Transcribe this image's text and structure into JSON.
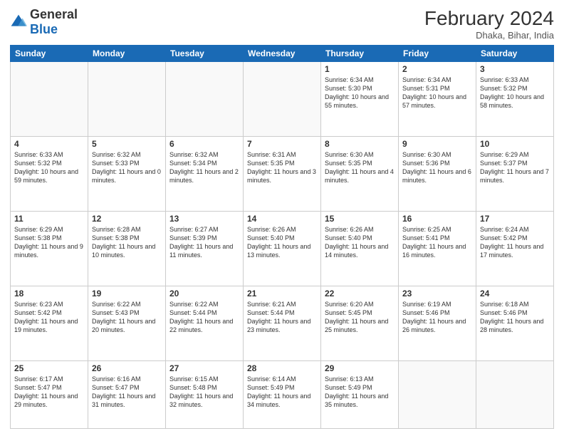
{
  "logo": {
    "general": "General",
    "blue": "Blue"
  },
  "header": {
    "title": "February 2024",
    "subtitle": "Dhaka, Bihar, India"
  },
  "weekdays": [
    "Sunday",
    "Monday",
    "Tuesday",
    "Wednesday",
    "Thursday",
    "Friday",
    "Saturday"
  ],
  "weeks": [
    [
      {
        "day": "",
        "sunrise": "",
        "sunset": "",
        "daylight": ""
      },
      {
        "day": "",
        "sunrise": "",
        "sunset": "",
        "daylight": ""
      },
      {
        "day": "",
        "sunrise": "",
        "sunset": "",
        "daylight": ""
      },
      {
        "day": "",
        "sunrise": "",
        "sunset": "",
        "daylight": ""
      },
      {
        "day": "1",
        "sunrise": "Sunrise: 6:34 AM",
        "sunset": "Sunset: 5:30 PM",
        "daylight": "Daylight: 10 hours and 55 minutes."
      },
      {
        "day": "2",
        "sunrise": "Sunrise: 6:34 AM",
        "sunset": "Sunset: 5:31 PM",
        "daylight": "Daylight: 10 hours and 57 minutes."
      },
      {
        "day": "3",
        "sunrise": "Sunrise: 6:33 AM",
        "sunset": "Sunset: 5:32 PM",
        "daylight": "Daylight: 10 hours and 58 minutes."
      }
    ],
    [
      {
        "day": "4",
        "sunrise": "Sunrise: 6:33 AM",
        "sunset": "Sunset: 5:32 PM",
        "daylight": "Daylight: 10 hours and 59 minutes."
      },
      {
        "day": "5",
        "sunrise": "Sunrise: 6:32 AM",
        "sunset": "Sunset: 5:33 PM",
        "daylight": "Daylight: 11 hours and 0 minutes."
      },
      {
        "day": "6",
        "sunrise": "Sunrise: 6:32 AM",
        "sunset": "Sunset: 5:34 PM",
        "daylight": "Daylight: 11 hours and 2 minutes."
      },
      {
        "day": "7",
        "sunrise": "Sunrise: 6:31 AM",
        "sunset": "Sunset: 5:35 PM",
        "daylight": "Daylight: 11 hours and 3 minutes."
      },
      {
        "day": "8",
        "sunrise": "Sunrise: 6:30 AM",
        "sunset": "Sunset: 5:35 PM",
        "daylight": "Daylight: 11 hours and 4 minutes."
      },
      {
        "day": "9",
        "sunrise": "Sunrise: 6:30 AM",
        "sunset": "Sunset: 5:36 PM",
        "daylight": "Daylight: 11 hours and 6 minutes."
      },
      {
        "day": "10",
        "sunrise": "Sunrise: 6:29 AM",
        "sunset": "Sunset: 5:37 PM",
        "daylight": "Daylight: 11 hours and 7 minutes."
      }
    ],
    [
      {
        "day": "11",
        "sunrise": "Sunrise: 6:29 AM",
        "sunset": "Sunset: 5:38 PM",
        "daylight": "Daylight: 11 hours and 9 minutes."
      },
      {
        "day": "12",
        "sunrise": "Sunrise: 6:28 AM",
        "sunset": "Sunset: 5:38 PM",
        "daylight": "Daylight: 11 hours and 10 minutes."
      },
      {
        "day": "13",
        "sunrise": "Sunrise: 6:27 AM",
        "sunset": "Sunset: 5:39 PM",
        "daylight": "Daylight: 11 hours and 11 minutes."
      },
      {
        "day": "14",
        "sunrise": "Sunrise: 6:26 AM",
        "sunset": "Sunset: 5:40 PM",
        "daylight": "Daylight: 11 hours and 13 minutes."
      },
      {
        "day": "15",
        "sunrise": "Sunrise: 6:26 AM",
        "sunset": "Sunset: 5:40 PM",
        "daylight": "Daylight: 11 hours and 14 minutes."
      },
      {
        "day": "16",
        "sunrise": "Sunrise: 6:25 AM",
        "sunset": "Sunset: 5:41 PM",
        "daylight": "Daylight: 11 hours and 16 minutes."
      },
      {
        "day": "17",
        "sunrise": "Sunrise: 6:24 AM",
        "sunset": "Sunset: 5:42 PM",
        "daylight": "Daylight: 11 hours and 17 minutes."
      }
    ],
    [
      {
        "day": "18",
        "sunrise": "Sunrise: 6:23 AM",
        "sunset": "Sunset: 5:42 PM",
        "daylight": "Daylight: 11 hours and 19 minutes."
      },
      {
        "day": "19",
        "sunrise": "Sunrise: 6:22 AM",
        "sunset": "Sunset: 5:43 PM",
        "daylight": "Daylight: 11 hours and 20 minutes."
      },
      {
        "day": "20",
        "sunrise": "Sunrise: 6:22 AM",
        "sunset": "Sunset: 5:44 PM",
        "daylight": "Daylight: 11 hours and 22 minutes."
      },
      {
        "day": "21",
        "sunrise": "Sunrise: 6:21 AM",
        "sunset": "Sunset: 5:44 PM",
        "daylight": "Daylight: 11 hours and 23 minutes."
      },
      {
        "day": "22",
        "sunrise": "Sunrise: 6:20 AM",
        "sunset": "Sunset: 5:45 PM",
        "daylight": "Daylight: 11 hours and 25 minutes."
      },
      {
        "day": "23",
        "sunrise": "Sunrise: 6:19 AM",
        "sunset": "Sunset: 5:46 PM",
        "daylight": "Daylight: 11 hours and 26 minutes."
      },
      {
        "day": "24",
        "sunrise": "Sunrise: 6:18 AM",
        "sunset": "Sunset: 5:46 PM",
        "daylight": "Daylight: 11 hours and 28 minutes."
      }
    ],
    [
      {
        "day": "25",
        "sunrise": "Sunrise: 6:17 AM",
        "sunset": "Sunset: 5:47 PM",
        "daylight": "Daylight: 11 hours and 29 minutes."
      },
      {
        "day": "26",
        "sunrise": "Sunrise: 6:16 AM",
        "sunset": "Sunset: 5:47 PM",
        "daylight": "Daylight: 11 hours and 31 minutes."
      },
      {
        "day": "27",
        "sunrise": "Sunrise: 6:15 AM",
        "sunset": "Sunset: 5:48 PM",
        "daylight": "Daylight: 11 hours and 32 minutes."
      },
      {
        "day": "28",
        "sunrise": "Sunrise: 6:14 AM",
        "sunset": "Sunset: 5:49 PM",
        "daylight": "Daylight: 11 hours and 34 minutes."
      },
      {
        "day": "29",
        "sunrise": "Sunrise: 6:13 AM",
        "sunset": "Sunset: 5:49 PM",
        "daylight": "Daylight: 11 hours and 35 minutes."
      },
      {
        "day": "",
        "sunrise": "",
        "sunset": "",
        "daylight": ""
      },
      {
        "day": "",
        "sunrise": "",
        "sunset": "",
        "daylight": ""
      }
    ]
  ]
}
